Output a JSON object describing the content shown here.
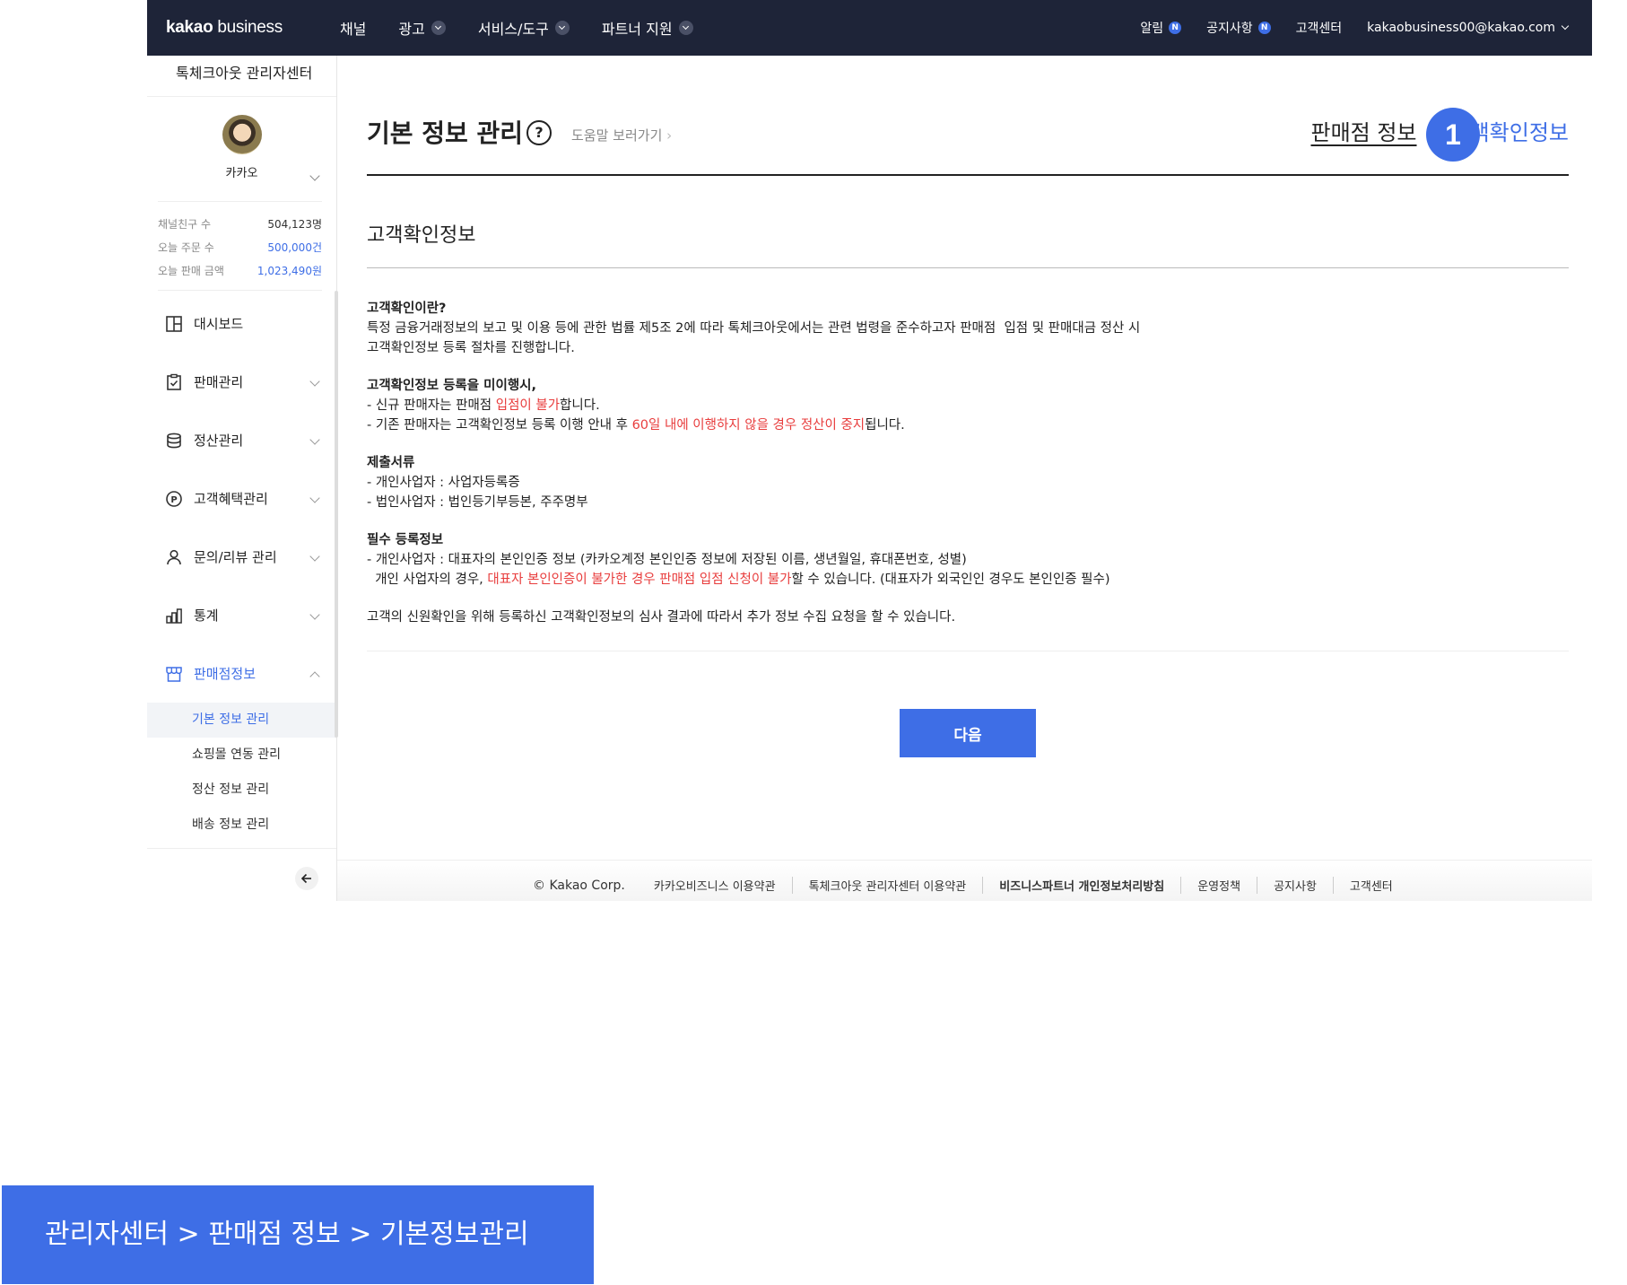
{
  "topnav": {
    "logo_main": "kakao",
    "logo_sub": " business",
    "menu": [
      {
        "label": "채널",
        "has_dropdown": false
      },
      {
        "label": "광고",
        "has_dropdown": true
      },
      {
        "label": "서비스/도구",
        "has_dropdown": true
      },
      {
        "label": "파트너 지원",
        "has_dropdown": true
      }
    ],
    "right": {
      "alert": "알림",
      "alert_badge": "N",
      "notice": "공지사항",
      "notice_badge": "N",
      "support": "고객센터",
      "account": "kakaobusiness00@kakao.com"
    }
  },
  "sidebar": {
    "title": "톡체크아웃 관리자센터",
    "profile_name": "카카오",
    "stats": [
      {
        "label": "채널친구 수",
        "value": "504,123명"
      },
      {
        "label": "오늘 주문 수",
        "value": "500,000건"
      },
      {
        "label": "오늘 판매 금액",
        "value": "1,023,490원"
      }
    ],
    "menu": [
      {
        "label": "대시보드",
        "icon": "dashboard-icon"
      },
      {
        "label": "판매관리",
        "icon": "clipboard-icon"
      },
      {
        "label": "정산관리",
        "icon": "database-icon"
      },
      {
        "label": "고객혜택관리",
        "icon": "point-icon"
      },
      {
        "label": "문의/리뷰 관리",
        "icon": "person-icon"
      },
      {
        "label": "통계",
        "icon": "bar-chart-icon"
      },
      {
        "label": "판매점정보",
        "icon": "store-icon"
      }
    ],
    "submenu": [
      {
        "label": "기본 정보 관리"
      },
      {
        "label": "쇼핑몰 연동 관리"
      },
      {
        "label": "정산 정보 관리"
      },
      {
        "label": "배송 정보 관리"
      }
    ]
  },
  "main": {
    "title": "기본 정보 관리",
    "help_icon": "?",
    "help_link": "도움말 보러가기",
    "tab_store": "판매점 정보",
    "tab_customer": "고객확인정보",
    "step_number": "1",
    "section_title": "고객확인정보",
    "blocks": [
      {
        "heading": "고객확인이란?",
        "lines": [
          [
            {
              "t": "특정 금융거래정보의 보고 및 이용 등에 관한 법률 제5조 2에 따라 톡체크아웃에서는 관련 법령을 준수하고자 판매점  입점 및 판매대금 정산 시"
            }
          ],
          [
            {
              "t": "고객확인정보 등록 절차를 진행합니다."
            }
          ]
        ]
      },
      {
        "heading": "고객확인정보 등록을 미이행시,",
        "lines": [
          [
            {
              "t": "- 신규 판매자는 판매점 "
            },
            {
              "t": "입점이 불가",
              "red": true
            },
            {
              "t": "합니다."
            }
          ],
          [
            {
              "t": "- 기존 판매자는 고객확인정보 등록 이행 안내 후 "
            },
            {
              "t": "60일 내에 이행하지 않을 경우 정산이 중지",
              "red": true
            },
            {
              "t": "됩니다."
            }
          ]
        ]
      },
      {
        "heading": "제출서류",
        "lines": [
          [
            {
              "t": "- 개인사업자 : 사업자등록증"
            }
          ],
          [
            {
              "t": "- 법인사업자 : 법인등기부등본, 주주명부"
            }
          ]
        ]
      },
      {
        "heading": "필수 등록정보",
        "lines": [
          [
            {
              "t": "- 개인사업자 : 대표자의 본인인증 정보 (카카오계정 본인인증 정보에 저장된 이름, 생년월일, 휴대폰번호, 성별)"
            }
          ],
          [
            {
              "t": "  개인 사업자의 경우, "
            },
            {
              "t": "대표자 본인인증이 불가한 경우 판매점 입점 신청이 불가",
              "red": true
            },
            {
              "t": "할 수 있습니다. (대표자가 외국인인 경우도 본인인증 필수)"
            }
          ]
        ]
      },
      {
        "heading": "",
        "lines": [
          [
            {
              "t": "고객의 신원확인을 위해 등록하신 고객확인정보의 심사 결과에 따라서 추가 정보 수집 요청을 할 수 있습니다."
            }
          ]
        ]
      }
    ],
    "next_button": "다음"
  },
  "footer": {
    "copyright": "© Kakao Corp.",
    "links": [
      {
        "label": "카카오비즈니스 이용약관",
        "bold": false
      },
      {
        "label": "톡체크아웃 관리자센터 이용약관",
        "bold": false
      },
      {
        "label": "비즈니스파트너 개인정보처리방침",
        "bold": true
      },
      {
        "label": "운영정책",
        "bold": false
      },
      {
        "label": "공지사항",
        "bold": false
      },
      {
        "label": "고객센터",
        "bold": false
      }
    ]
  },
  "banner": {
    "text": "관리자센터 > 판매점 정보 > 기본정보관리"
  },
  "colors": {
    "accent": "#3e6ee6",
    "nav_bg": "#1e2438",
    "warning": "#e83d3d"
  }
}
